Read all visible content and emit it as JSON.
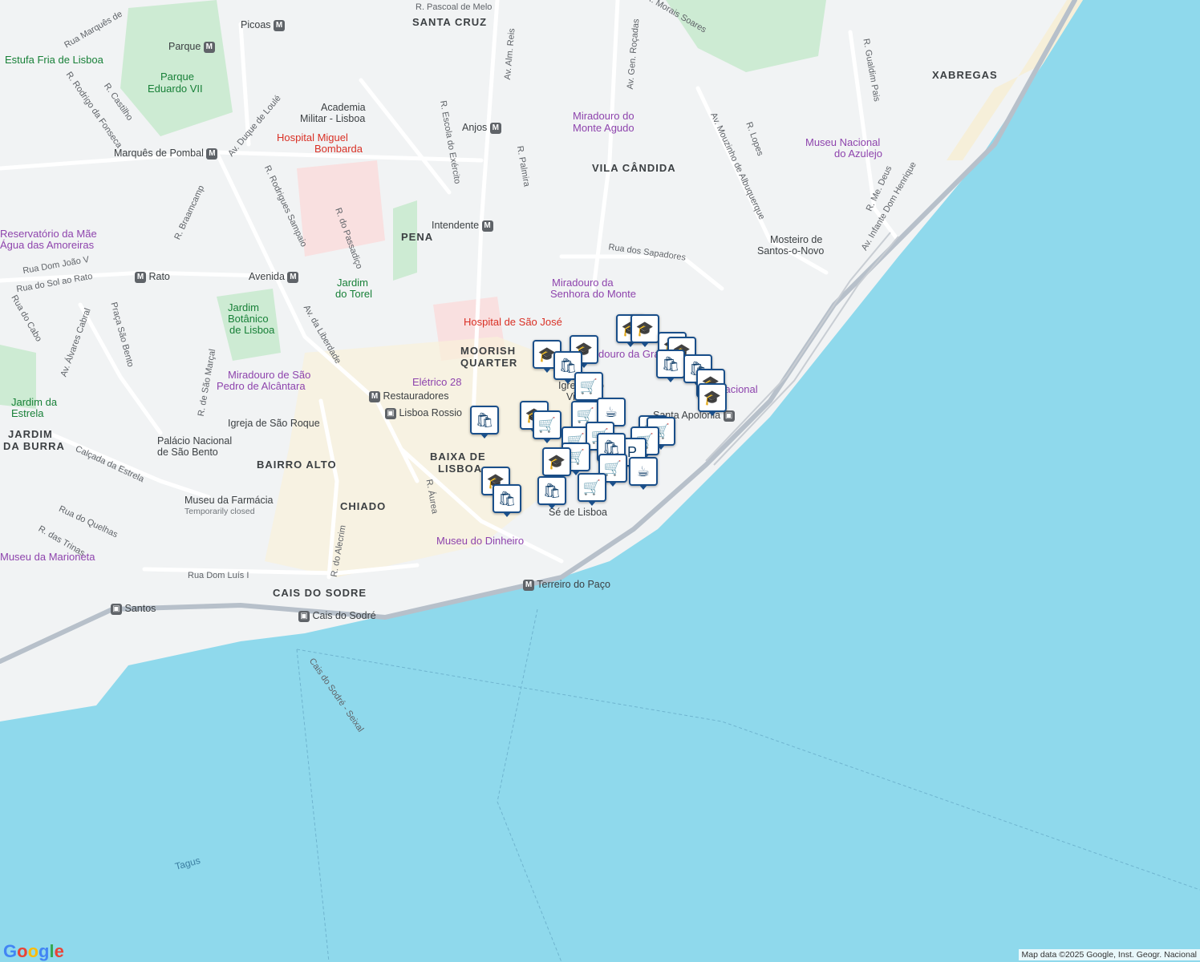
{
  "map": {
    "colors": {
      "water": "#8fd9ec",
      "land": "#f1f3f4",
      "park": "#cdebd3",
      "road": "#ffffff",
      "major_road": "#b7c0ca",
      "pin_border": "#1a4f8a"
    },
    "districts": [
      "SANTA CRUZ",
      "VILA CÂNDIDA",
      "XABREGAS",
      "PENA",
      "MOORISH QUARTER",
      "BAIXA DE",
      "LISBOA",
      "BAIRRO ALTO",
      "CHIADO",
      "CAIS DO SODRE",
      "JARDIM",
      "DA BURRA"
    ],
    "roads": [
      "R. Pascoal de Melo",
      "R. Morais Soares",
      "R. Gualdim Pais",
      "Rua Marquês de",
      "R. Rodrigo da Fonseca",
      "R. Castilho",
      "Av. Duque de Loulé",
      "R. Escola do Exército",
      "Av. Alm. Reis",
      "R. Palmira",
      "Av. Gen. Roçadas",
      "Av. Mouzinho de Albuquerque",
      "R. Lopes",
      "R. Me. Deus",
      "Av. Infante Dom Henrique",
      "R. Rodrigues Sampaio",
      "R. do Passadiço",
      "R. Braamcamp",
      "Rua Dom João V",
      "Rua do Sol ao Rato",
      "Av. da Liberdade",
      "Rua dos Sapadores",
      "Av. Álvares Cabral",
      "Praça São Bento",
      "Rua do Cabo",
      "R. de São Marçal",
      "Calçada da Estrela",
      "Rua do Quelhas",
      "R. das Trinas",
      "Rua Dom Luís I",
      "R. do Alecrim",
      "R. Áurea",
      "Cais do Sodré - Seixal",
      "Tagus"
    ],
    "transit": [
      "Picoas",
      "Parque",
      "Anjos",
      "Intendente",
      "Avenida",
      "Rato",
      "Restauradores",
      "Lisboa Rossio",
      "Terreiro do Paço",
      "Santos",
      "Cais do Sodré",
      "Santa Apolónia",
      "Marquês de Pombal"
    ],
    "pois": [
      "Estufa Fria de Lisboa",
      "Parque",
      "Eduardo VII",
      "Academia",
      "Militar - Lisboa",
      "Hospital Miguel",
      "Bombarda",
      "Miradouro do",
      "Monte Agudo",
      "Museu Nacional",
      "do Azulejo",
      "Mosteiro de",
      "Santos-o-Novo",
      "Reservatório da Mãe",
      "Água das Amoreiras",
      "Jardim",
      "do Torel",
      "Miradouro da",
      "Senhora do Monte",
      "Hospital de São José",
      "Jardim",
      "Botânico",
      "de Lisboa",
      "Miradouro de São",
      "Pedro de Alcântara",
      "Elétrico 28",
      "Igreja de São Roque",
      "Palácio Nacional",
      "de São Bento",
      "Museu da Farmácia",
      "Temporarily closed",
      "Museu da Marioneta",
      "Museu do Dinheiro",
      "Sé de Lisboa",
      "douro da Graça",
      "Igreja São",
      "Vicente",
      "ão Nacional",
      "Jardim da",
      "Estrela"
    ],
    "attribution": "Map data ©2025 Google, Inst. Geogr. Nacional",
    "logo": "Google"
  }
}
